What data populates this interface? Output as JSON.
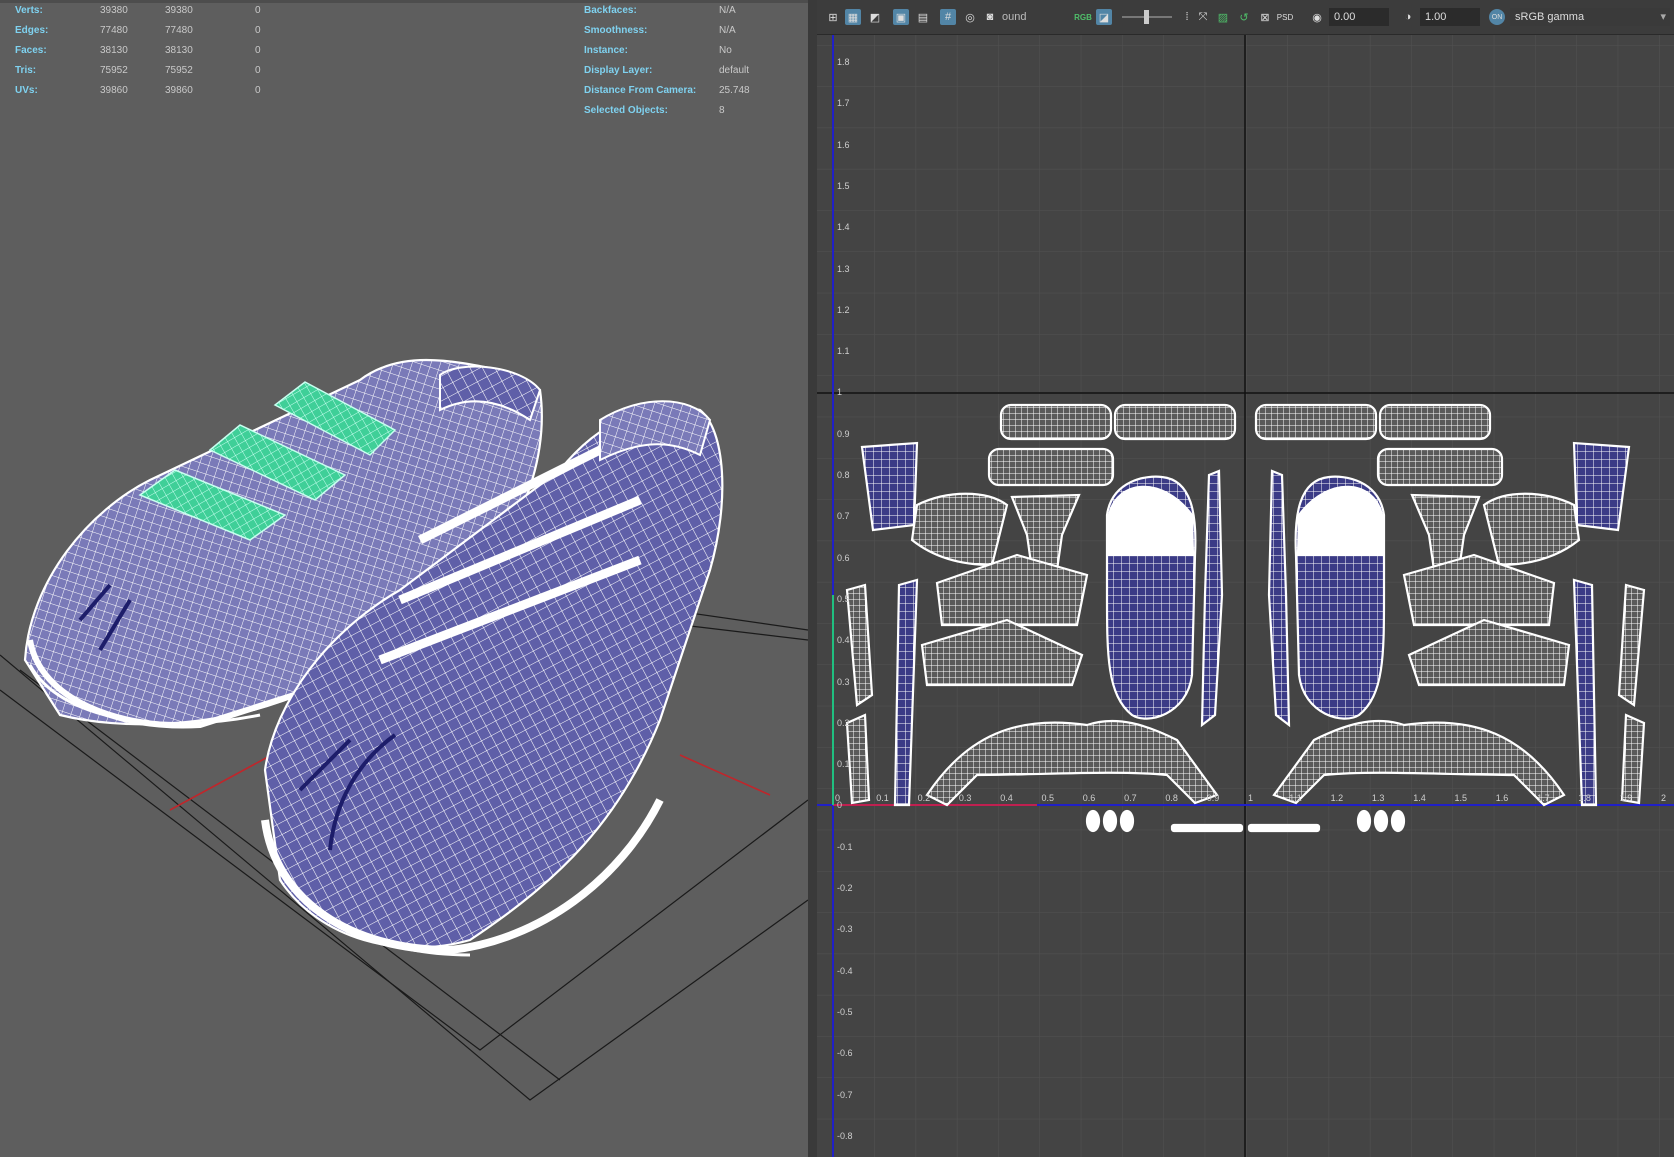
{
  "hud": {
    "left": [
      {
        "label": "Verts:",
        "v1": "39380",
        "v2": "39380",
        "v3": "0"
      },
      {
        "label": "Edges:",
        "v1": "77480",
        "v2": "77480",
        "v3": "0"
      },
      {
        "label": "Faces:",
        "v1": "38130",
        "v2": "38130",
        "v3": "0"
      },
      {
        "label": "Tris:",
        "v1": "75952",
        "v2": "75952",
        "v3": "0"
      },
      {
        "label": "UVs:",
        "v1": "39860",
        "v2": "39860",
        "v3": "0"
      }
    ],
    "right": [
      {
        "label": "Backfaces:",
        "value": "N/A"
      },
      {
        "label": "Smoothness:",
        "value": "N/A"
      },
      {
        "label": "Instance:",
        "value": "No"
      },
      {
        "label": "Display Layer:",
        "value": "default"
      },
      {
        "label": "Distance From Camera:",
        "value": "25.748"
      },
      {
        "label": "Selected Objects:",
        "value": "8"
      }
    ]
  },
  "toolbar": {
    "image_name_partial": "ound",
    "channel_label": "RGB",
    "exposure_value": "0.00",
    "gamma_value": "1.00",
    "colorspace_badge": "ON",
    "colorspace": "sRGB gamma",
    "psd_label": "PSD"
  },
  "uv_axes": {
    "v_ticks": [
      "1.8",
      "1.7",
      "1.6",
      "1.5",
      "1.4",
      "1.3",
      "1.2",
      "1.1",
      "1",
      "0.9",
      "0.8",
      "0.7",
      "0.6",
      "0.5",
      "0.4",
      "0.3",
      "0.2",
      "0.1",
      "0",
      "-0.1",
      "-0.2",
      "-0.3",
      "-0.4",
      "-0.5",
      "-0.6",
      "-0.7",
      "-0.8"
    ],
    "u_ticks": [
      "0",
      "0.1",
      "0.2",
      "0.3",
      "0.4",
      "0.5",
      "0.6",
      "0.7",
      "0.8",
      "0.9",
      "1",
      "1.1",
      "1.2",
      "1.3",
      "1.4",
      "1.5",
      "1.6",
      "1.7",
      "1.8",
      "1.9",
      "2"
    ]
  },
  "colors": {
    "viewport_bg": "#5e5e5e",
    "uv_bg": "#444444",
    "wire": "#ffffff",
    "shell_fill": "#3b3b86",
    "selected_strap": "#53e0a8",
    "hud_label": "#7fd2f0"
  }
}
